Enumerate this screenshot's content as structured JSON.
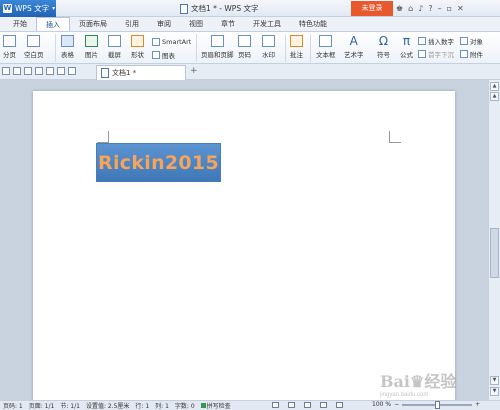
{
  "app": {
    "name": "WPS 文字",
    "logo": "W"
  },
  "window": {
    "title": "文档1 * - WPS 文字",
    "login_button": "未登录"
  },
  "title_icons": [
    "shirt-icon",
    "home-icon",
    "bell-icon",
    "help-icon",
    "minimize-icon",
    "restore-icon",
    "close-icon"
  ],
  "menu": {
    "tabs": [
      "开始",
      "插入",
      "页面布局",
      "引用",
      "审阅",
      "视图",
      "章节",
      "开发工具",
      "特色功能"
    ],
    "active": "插入"
  },
  "ribbon": {
    "page_break": "分页",
    "blank_page": "空白页",
    "table": "表格",
    "picture": "图片",
    "screenshot": "截屏",
    "shape": "形状",
    "chart": "图表",
    "smartart": "SmartArt",
    "header_footer": "页眉和页脚",
    "page_number": "页码",
    "watermark": "水印",
    "comment": "批注",
    "textbox": "文本框",
    "wordart": "艺术字",
    "symbol": "符号",
    "formula": "公式",
    "insert_number": "插入数字",
    "object": "对象",
    "drop_cap": "首字下沉",
    "attachment": "附件"
  },
  "document_tab": {
    "label": "文档1 *"
  },
  "document": {
    "textbox_text": "Rickin2015"
  },
  "status": {
    "page": "页码: 1",
    "pages": "页面: 1/1",
    "section": "节: 1/1",
    "setting": "设置值: 2.5厘米",
    "row": "行: 1",
    "col": "列: 1",
    "words": "字数: 0",
    "spell": "拼写检查",
    "zoom": "100 %"
  },
  "zoom_level": 0.5,
  "watermark": {
    "main": "Bai♛经验",
    "sub": "jingyan.baidu.com"
  },
  "colors": {
    "accent": "#1f63b5",
    "login": "#e9582c",
    "textbox_fill": "#4a86c6",
    "textbox_text": "#f7a35a"
  }
}
